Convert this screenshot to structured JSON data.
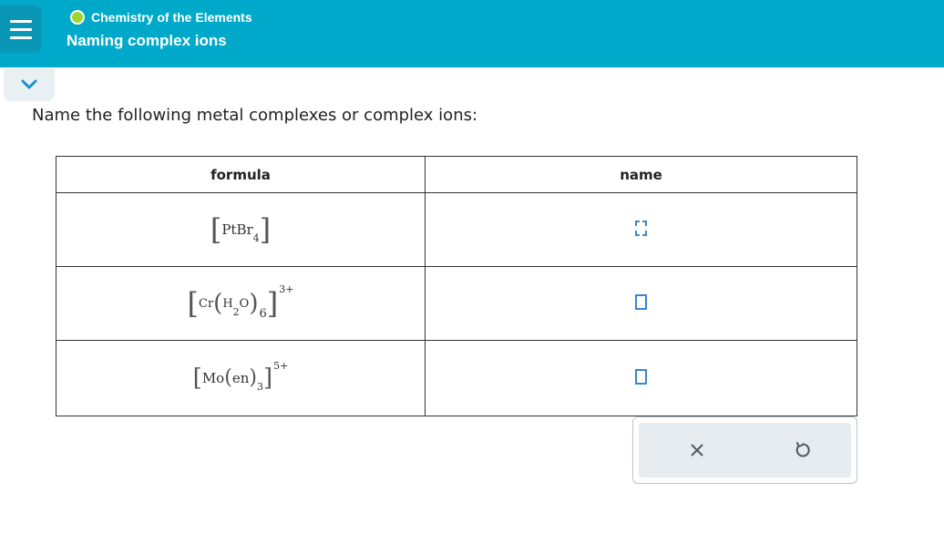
{
  "header": {
    "course_title": "Chemistry of the Elements",
    "page_title": "Naming complex ions",
    "status_color": "#9dd62c",
    "accent_color": "#00a9c9"
  },
  "prompt": "Name the following metal complexes or complex ions:",
  "table": {
    "columns": [
      "formula",
      "name"
    ],
    "rows": [
      {
        "formula": {
          "metal": "PtBr",
          "ligand_sub": "4",
          "charge": ""
        },
        "name": ""
      },
      {
        "formula": {
          "metal": "Cr",
          "ligand": "H",
          "ligand_sub_inner": "2",
          "ligand_rest": "O",
          "ligand_count": "6",
          "charge": "3+"
        },
        "name": ""
      },
      {
        "formula": {
          "metal": "Mo",
          "ligand": "en",
          "ligand_count": "3",
          "charge": "5+"
        },
        "name": ""
      }
    ]
  },
  "tools": {
    "clear_icon": "x-icon",
    "undo_icon": "undo-icon",
    "clear_symbol": "✕"
  }
}
